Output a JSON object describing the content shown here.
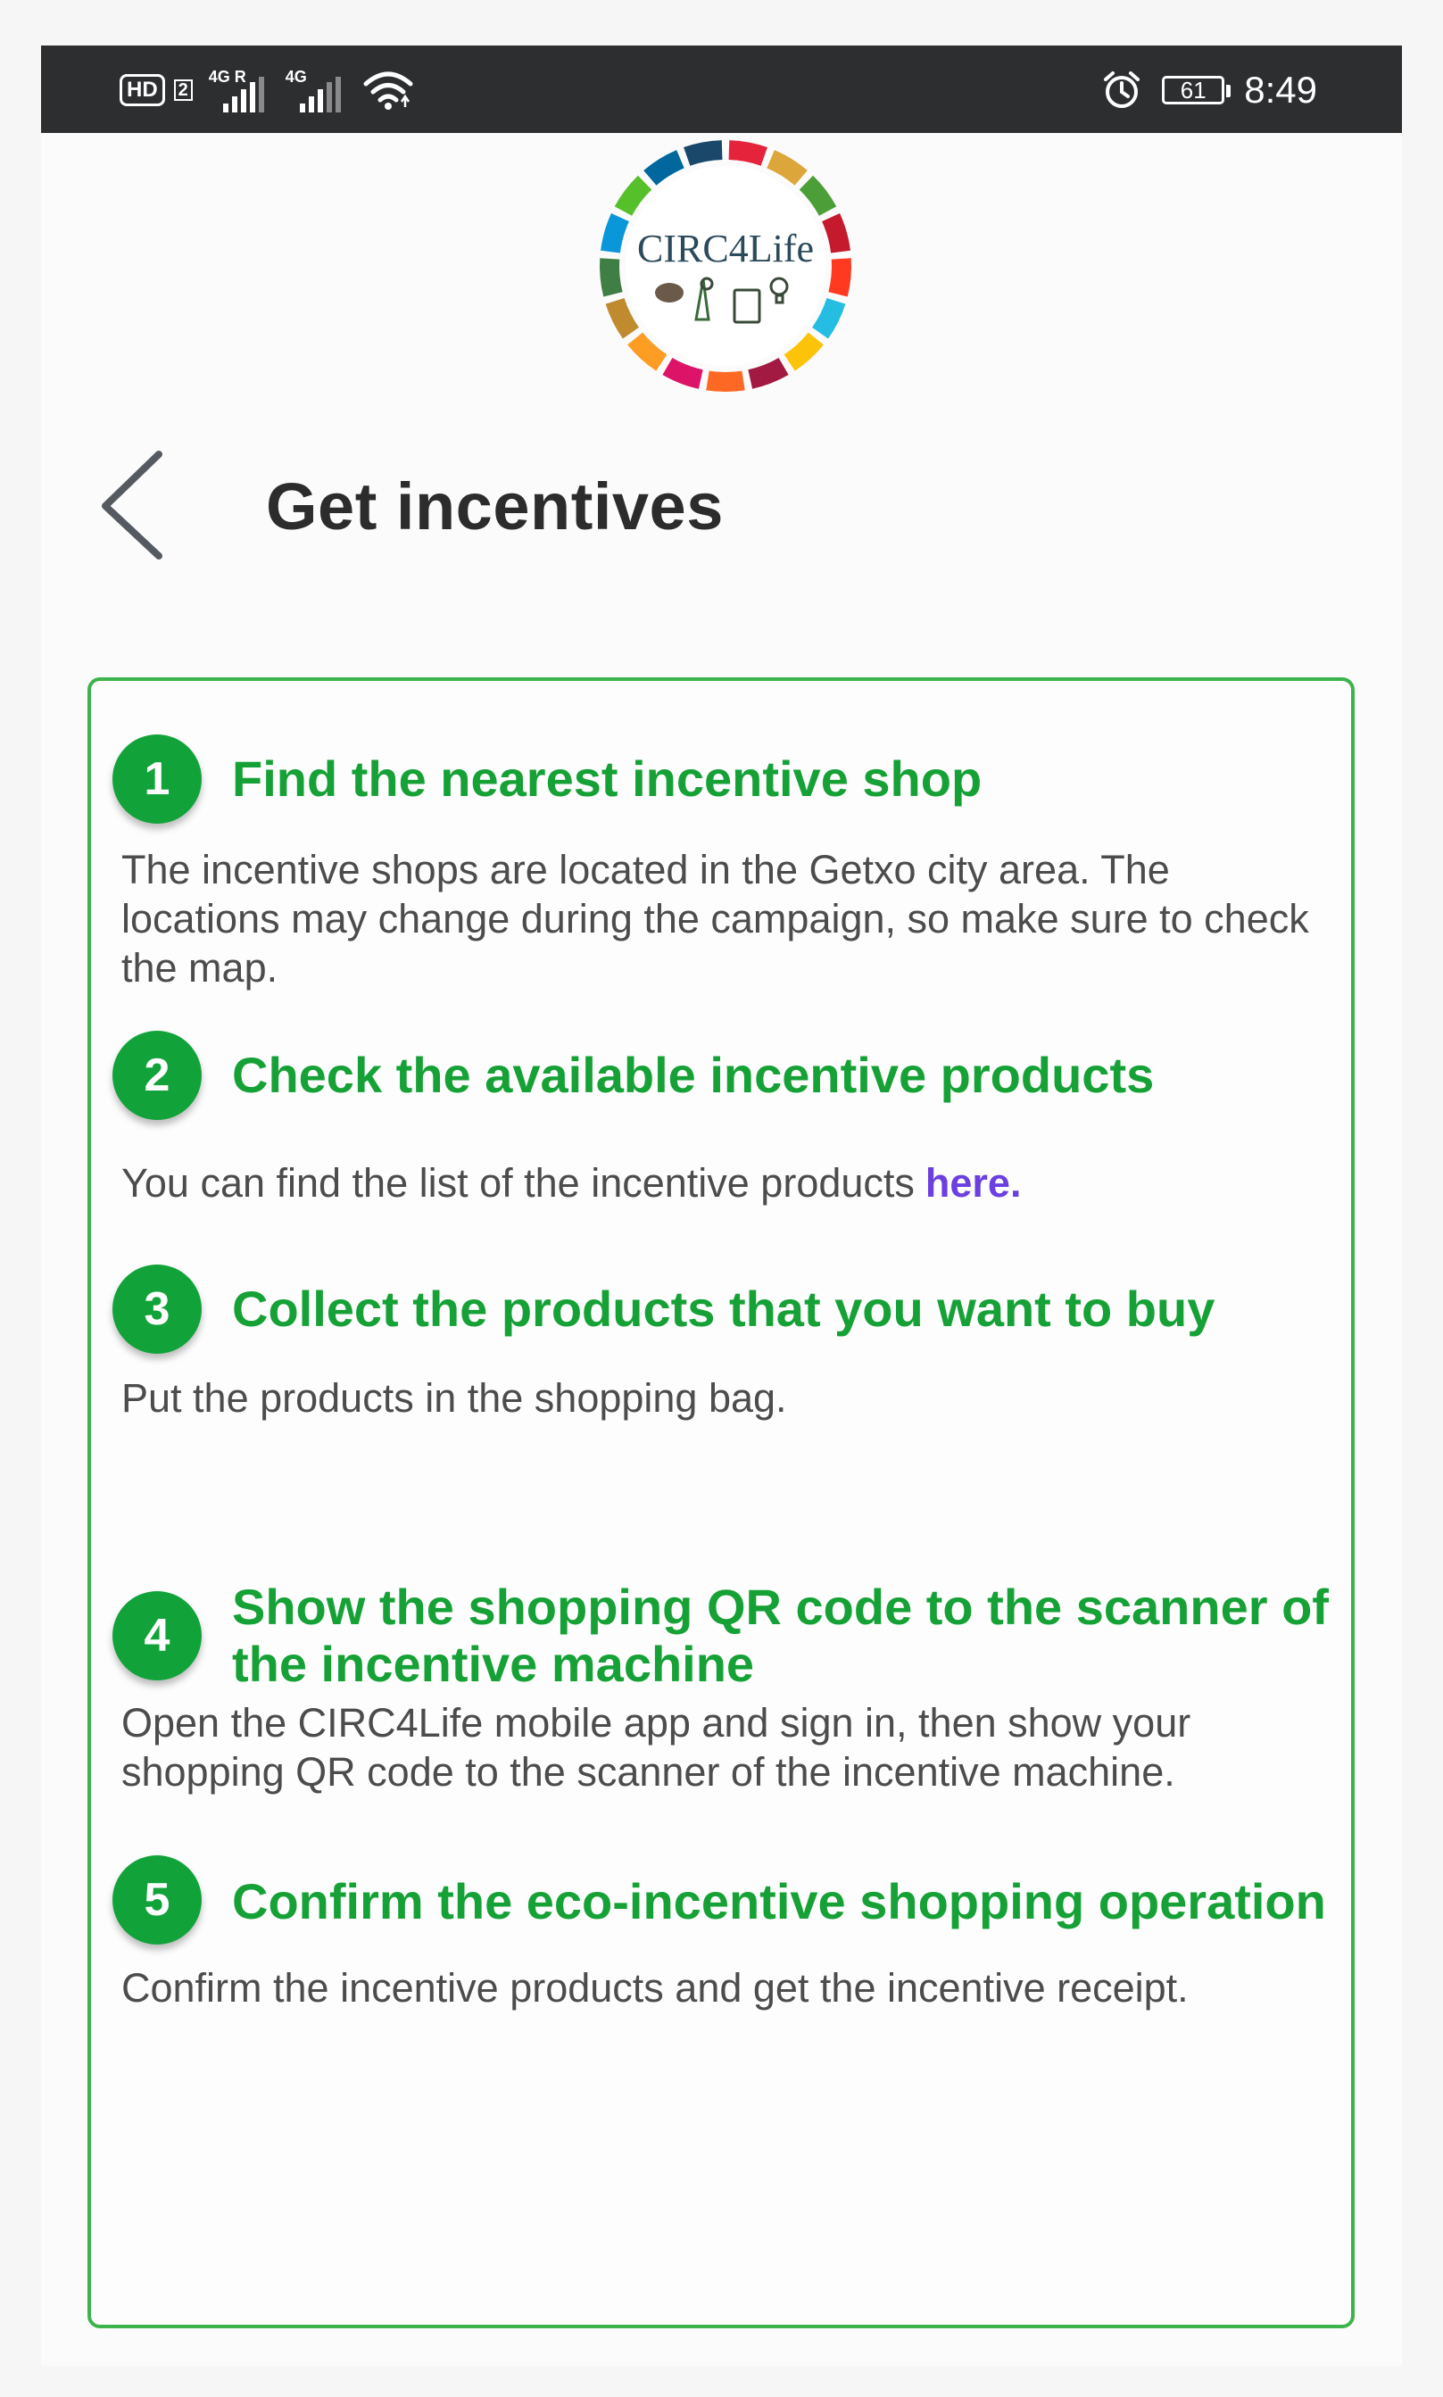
{
  "statusbar": {
    "hd_label": "HD",
    "sim_number": "2",
    "network1": "4G R",
    "network2": "4G",
    "battery_level": "61",
    "time": "8:49"
  },
  "logo": {
    "text": "CIRC4Life",
    "ring_colors": [
      "#e5243b",
      "#dda63a",
      "#4c9f38",
      "#c5192d",
      "#ff3a21",
      "#26bde2",
      "#fcc30b",
      "#a21942",
      "#fd6925",
      "#dd1367",
      "#fd9d24",
      "#bf8b2e",
      "#3f7e44",
      "#0a97d9",
      "#56c02b",
      "#00689d",
      "#19486a"
    ]
  },
  "header": {
    "title": "Get incentives",
    "back_icon": "chevron-left-icon"
  },
  "steps": [
    {
      "number": "1",
      "title": "Find the nearest incentive shop",
      "description": "The incentive shops are located in the Getxo city area. The locations may change during the campaign, so make sure to check the map."
    },
    {
      "number": "2",
      "title": "Check the available incentive products",
      "description": "You can find the list of the incentive products",
      "link": "here."
    },
    {
      "number": "3",
      "title": "Collect the products that you want to buy",
      "description": "Put the products in the shopping bag."
    },
    {
      "number": "4",
      "title": "Show the shopping QR code to the scanner of the incentive machine",
      "description": "Open the CIRC4Life mobile app and sign in, then show your shopping QR code to the scanner of the incentive machine."
    },
    {
      "number": "5",
      "title": "Confirm the eco-incentive shopping operation",
      "description": "Confirm the incentive products and get the incentive receipt."
    }
  ],
  "colors": {
    "accent_green": "#16a136",
    "badge_green": "#11a33a",
    "card_border": "#3cb44b",
    "link_purple": "#6b3fe0",
    "statusbar_bg": "#2d2e30"
  }
}
